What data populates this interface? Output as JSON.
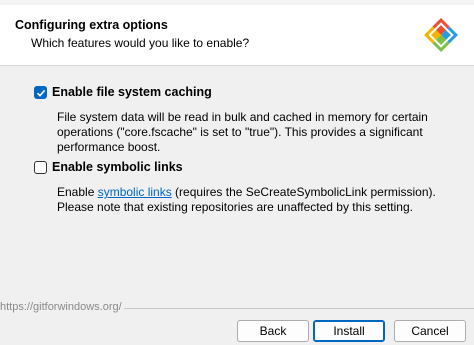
{
  "header": {
    "title": "Configuring extra options",
    "subtitle": "Which features would you like to enable?",
    "logo_icon": "git-logo-icon"
  },
  "options": [
    {
      "label": "Enable file system caching",
      "checked": true,
      "description": "File system data will be read in bulk and cached in memory for certain operations (\"core.fscache\" is set to \"true\"). This provides a significant performance boost."
    },
    {
      "label": "Enable symbolic links",
      "checked": false,
      "desc_before_link": "Enable ",
      "link_text": "symbolic links",
      "desc_after_link": " (requires the SeCreateSymbolicLink permission). Please note that existing repositories are unaffected by this setting."
    }
  ],
  "footer": {
    "url": "https://gitforwindows.org/"
  },
  "buttons": {
    "back": "Back",
    "install": "Install",
    "cancel": "Cancel"
  },
  "colors": {
    "accent": "#0067c0",
    "link": "#0066cc"
  }
}
